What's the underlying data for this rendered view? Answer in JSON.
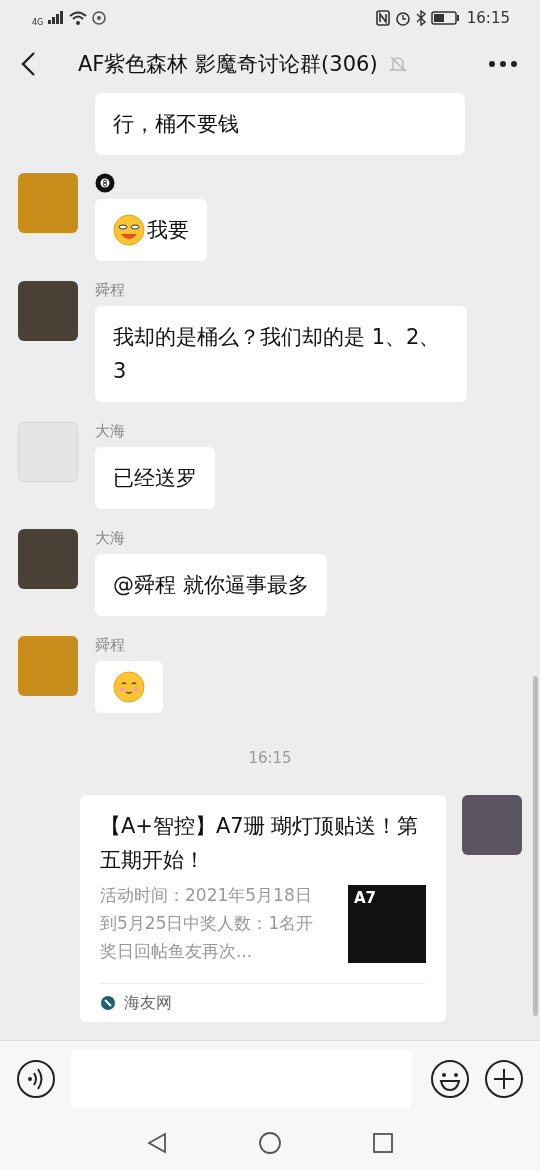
{
  "status_bar": {
    "network": "4G",
    "time": "16:15"
  },
  "header": {
    "title": "AF紫色森林 影魔奇讨论群(306)",
    "muted": true
  },
  "messages": [
    {
      "kind": "text",
      "cut": true,
      "text": "行，桶不要钱"
    },
    {
      "kind": "text",
      "name_badge": true,
      "emoji_prefix": true,
      "text": "我要"
    },
    {
      "kind": "text",
      "name": "舜程",
      "text": "我却的是桶么？我们却的是 1、2、3"
    },
    {
      "kind": "text",
      "name": "大海",
      "text": "已经送罗"
    },
    {
      "kind": "text",
      "name": "大海",
      "text": "@舜程  就你逼事最多"
    },
    {
      "kind": "emoji",
      "name": "舜程"
    },
    {
      "kind": "time",
      "text": "16:15"
    },
    {
      "kind": "link",
      "title": "【A+智控】A7珊 瑚灯顶贴送！第五期开始！",
      "desc": "活动时间：2021年5月18日到5月25日中奖人数：1名开奖日回帖鱼友再次...",
      "thumb_text": "A7",
      "source": "海友网"
    }
  ]
}
